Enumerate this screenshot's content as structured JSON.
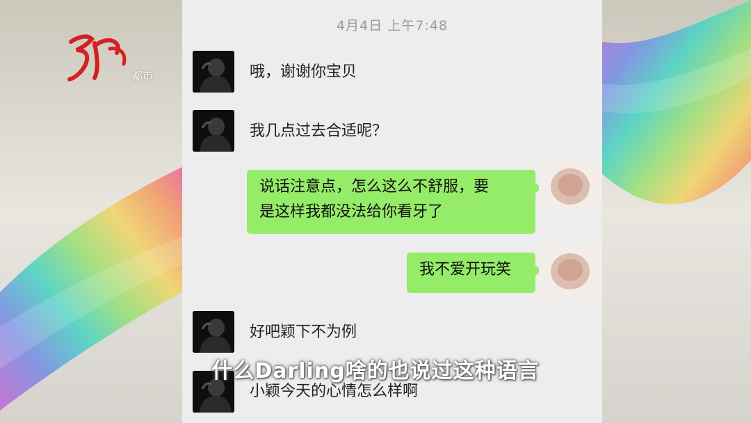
{
  "chat": {
    "timestamp": "4月4日 上午7:48",
    "messages": [
      {
        "side": "left",
        "text": "哦，谢谢你宝贝"
      },
      {
        "side": "left",
        "text": "我几点过去合适呢？"
      },
      {
        "side": "right",
        "lines": [
          "说话注意点，怎么这么不舒服，要",
          "是这样我都没法给你看牙了"
        ]
      },
      {
        "side": "right",
        "text": "我不爱开玩笑"
      },
      {
        "side": "left",
        "text": "好吧颖下不为例"
      },
      {
        "side": "left",
        "text": "小颖今天的心情怎么样啊"
      }
    ],
    "bubble_color": "#95ec69",
    "background_color": "#ededed"
  },
  "caption": "什么Darling啥的也说过这种语言",
  "logo": {
    "label": "都市",
    "color": "#d42020"
  }
}
